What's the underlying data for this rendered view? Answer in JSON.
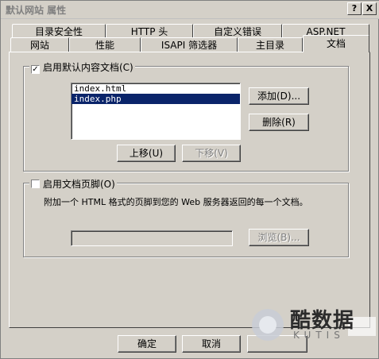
{
  "window": {
    "title": "默认网站 属性",
    "help_btn": "?",
    "close_btn": "X"
  },
  "tabs_back": [
    "目录安全性",
    "HTTP 头",
    "自定义错误",
    "ASP.NET"
  ],
  "tabs_front": [
    "网站",
    "性能",
    "ISAPI 筛选器",
    "主目录",
    "文档"
  ],
  "default_doc": {
    "checkbox_label": "启用默认内容文档(C)",
    "checked": true,
    "items": [
      "index.html",
      "index.php"
    ],
    "selected_index": 1,
    "add_label": "添加(D)...",
    "remove_label": "删除(R)",
    "up_label": "上移(U)",
    "down_label": "下移(V)"
  },
  "footer_doc": {
    "checkbox_label": "启用文档页脚(O)",
    "checked": false,
    "description": "附加一个 HTML 格式的页脚到您的 Web 服务器返回的每一个文档。",
    "path_value": "",
    "browse_label": "浏览(B)..."
  },
  "buttons": {
    "ok": "确定",
    "cancel": "取消"
  },
  "watermark": {
    "text": "酷数据",
    "subtext": "KUTIS"
  }
}
